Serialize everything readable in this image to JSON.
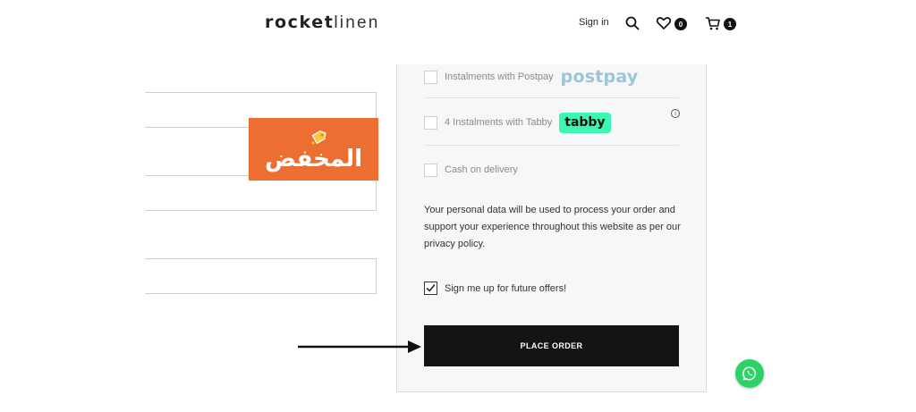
{
  "header": {
    "logo_part1": "rocket",
    "logo_part2": "linen",
    "signin_label": "Sign in",
    "wishlist_count": "0",
    "cart_count": "1"
  },
  "promo": {
    "text": "المخفض",
    "color": "#ec6f31"
  },
  "payment": {
    "options": [
      {
        "label": "Instalments with Postpay",
        "brand": "postpay"
      },
      {
        "label": "4 Instalments with Tabby",
        "brand": "tabby"
      },
      {
        "label": "Cash on delivery"
      }
    ],
    "privacy_text_before": "Your personal data will be used to process your order and support your experience throughout this website as per our ",
    "privacy_link": "privacy policy",
    "privacy_text_after": ".",
    "signup_label": "Sign me up for future offers!",
    "signup_checked": true,
    "place_order_label": "PLACE ORDER"
  },
  "colors": {
    "postpay": "#9cc6d6",
    "tabby": "#3cf7b0",
    "whatsapp": "#2bd366",
    "button": "#141414"
  }
}
